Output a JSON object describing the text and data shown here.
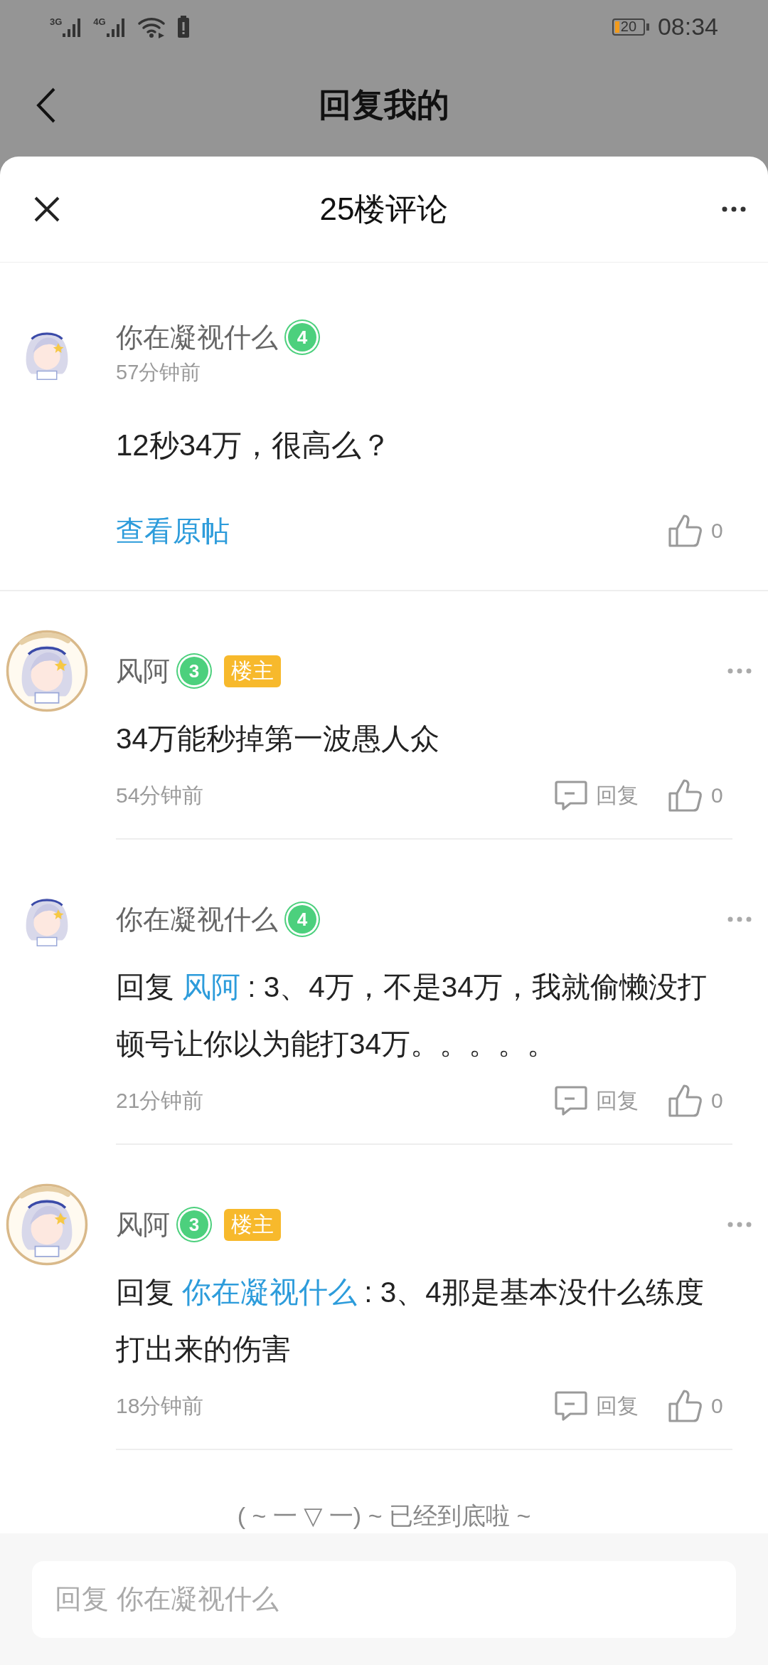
{
  "status_bar": {
    "networks": [
      "3G",
      "4G"
    ],
    "battery": "20",
    "time": "08:34"
  },
  "page_header": {
    "title": "回复我的"
  },
  "sheet": {
    "title": "25楼评论"
  },
  "main_comment": {
    "user": "你在凝视什么",
    "rank": "4",
    "avatar_framed": false,
    "time": "57分钟前",
    "content": "12秒34万，很高么？",
    "link": "查看原帖",
    "likes": "0"
  },
  "replies": [
    {
      "user": "风阿",
      "rank": "3",
      "avatar_framed": true,
      "tag": "楼主",
      "content": "34万能秒掉第一波愚人众",
      "time": "54分钟前",
      "reply_label": "回复",
      "likes": "0"
    },
    {
      "user": "你在凝视什么",
      "rank": "4",
      "avatar_framed": false,
      "reply_prefix": "回复",
      "reply_to": "风阿",
      "content": ": 3、4万，不是34万，我就偷懒没打顿号让你以为能打34万。。。。。",
      "time": "21分钟前",
      "reply_label": "回复",
      "likes": "0"
    },
    {
      "user": "风阿",
      "rank": "3",
      "avatar_framed": true,
      "tag": "楼主",
      "reply_prefix": "回复",
      "reply_to": "你在凝视什么",
      "content": ": 3、4那是基本没什么练度打出来的伤害",
      "time": "18分钟前",
      "reply_label": "回复",
      "likes": "0"
    }
  ],
  "end_text": "( ~ 一 ▽ 一) ~ 已经到底啦 ~",
  "reply_field": {
    "placeholder": "回复 你在凝视什么"
  }
}
